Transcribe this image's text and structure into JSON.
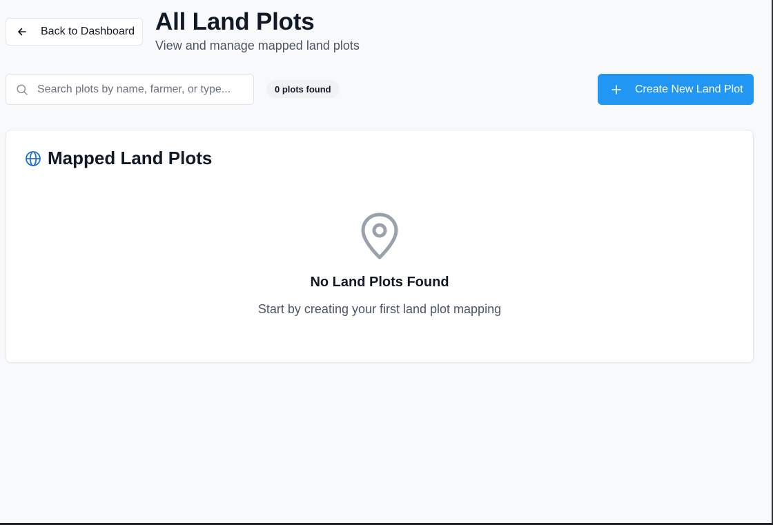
{
  "header": {
    "back_label": "Back to Dashboard",
    "title": "All Land Plots",
    "subtitle": "View and manage mapped land plots"
  },
  "toolbar": {
    "search_placeholder": "Search plots by name, farmer, or type...",
    "search_value": "",
    "count_label": "0 plots found",
    "create_label": "Create New Land Plot"
  },
  "card": {
    "title": "Mapped Land Plots",
    "empty_heading": "No Land Plots Found",
    "empty_description": "Start by creating your first land plot mapping"
  },
  "icons": {
    "back": "arrow-left-icon",
    "search": "search-icon",
    "create": "plus-icon",
    "card": "globe-icon",
    "empty": "map-pin-icon"
  },
  "colors": {
    "accent": "#2196f3",
    "globe_icon": "#1e6fd9",
    "empty_icon": "#9aa1ab",
    "background": "#f8f9fb"
  }
}
